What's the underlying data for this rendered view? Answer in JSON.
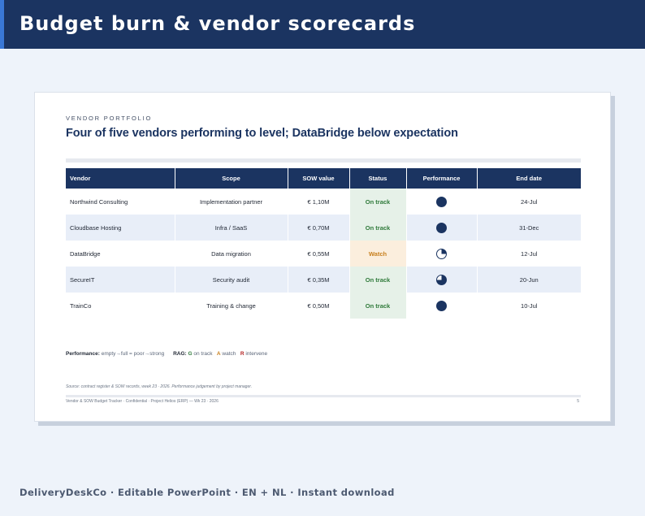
{
  "header": {
    "title": "Budget burn & vendor scorecards"
  },
  "slide": {
    "eyebrow": "VENDOR PORTFOLIO",
    "title": "Four of five vendors performing to level; DataBridge below expectation",
    "columns": [
      "Vendor",
      "Scope",
      "SOW value",
      "Status",
      "Performance",
      "End date"
    ],
    "rows": [
      {
        "vendor": "Northwind Consulting",
        "scope": "Implementation partner",
        "sow": "€ 1,10M",
        "status": "On track",
        "status_key": "green",
        "performance": 1.0,
        "end": "24-Jul"
      },
      {
        "vendor": "Cloudbase Hosting",
        "scope": "Infra / SaaS",
        "sow": "€ 0,70M",
        "status": "On track",
        "status_key": "green",
        "performance": 1.0,
        "end": "31-Dec"
      },
      {
        "vendor": "DataBridge",
        "scope": "Data migration",
        "sow": "€ 0,55M",
        "status": "Watch",
        "status_key": "amber",
        "performance": 0.25,
        "end": "12-Jul"
      },
      {
        "vendor": "SecureIT",
        "scope": "Security audit",
        "sow": "€ 0,35M",
        "status": "On track",
        "status_key": "green",
        "performance": 0.75,
        "end": "20-Jun"
      },
      {
        "vendor": "TrainCo",
        "scope": "Training & change",
        "sow": "€ 0,50M",
        "status": "On track",
        "status_key": "green",
        "performance": 1.0,
        "end": "10-Jul"
      }
    ],
    "legend": {
      "performance_label": "Performance:",
      "performance_text": "empty→full = poor→strong",
      "rag_label": "RAG:",
      "g": "G",
      "g_text": "on track",
      "a": "A",
      "a_text": "watch",
      "r": "R",
      "r_text": "intervene"
    },
    "source": "Source: contract register & SOW records, week 23 · 2026. Performance judgement by project manager.",
    "footer": "Vendor & SOW Budget Tracker  ·  Confidential  ·  Project Helios (ERP) — Wk 23 · 2026",
    "page_number": "5"
  },
  "tagline": "DeliveryDeskCo · Editable PowerPoint · EN + NL · Instant download",
  "colors": {
    "navy": "#1b3461",
    "green": "#2f7a3a",
    "amber": "#c8801f",
    "red": "#b32121"
  }
}
